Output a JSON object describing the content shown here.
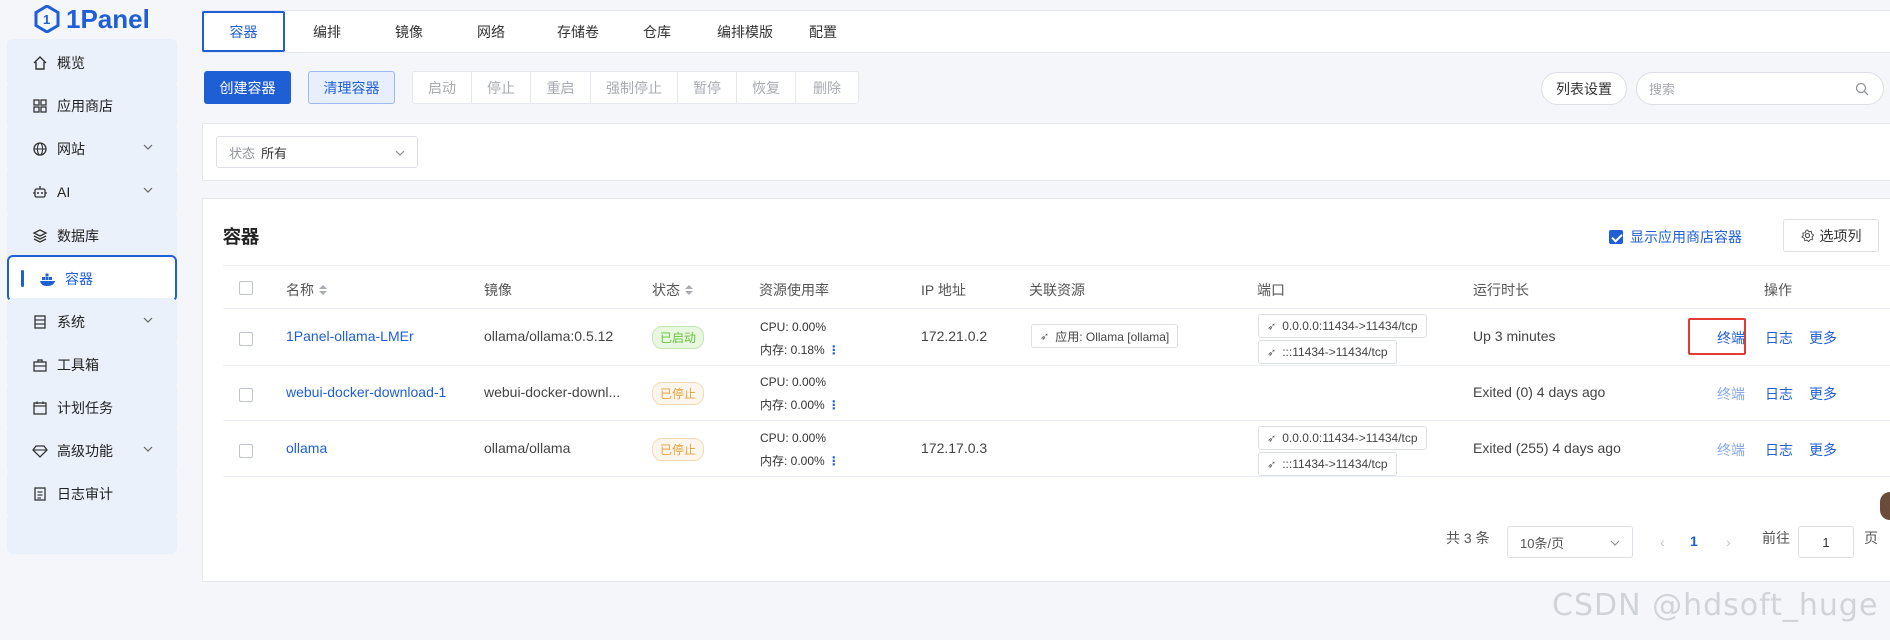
{
  "app": {
    "brand": "1Panel"
  },
  "sidebar": {
    "items": [
      {
        "label": "概览",
        "icon": "home-icon"
      },
      {
        "label": "应用商店",
        "icon": "grid-icon"
      },
      {
        "label": "网站",
        "icon": "globe-icon"
      },
      {
        "label": "AI",
        "icon": "robot-icon"
      },
      {
        "label": "数据库",
        "icon": "layers-icon"
      },
      {
        "label": "容器",
        "icon": "docker-icon",
        "active": true
      },
      {
        "label": "系统",
        "icon": "server-icon"
      },
      {
        "label": "工具箱",
        "icon": "toolbox-icon"
      },
      {
        "label": "计划任务",
        "icon": "calendar-icon"
      },
      {
        "label": "高级功能",
        "icon": "diamond-icon"
      },
      {
        "label": "日志审计",
        "icon": "log-icon"
      }
    ]
  },
  "tabs": [
    "容器",
    "编排",
    "镜像",
    "网络",
    "存储卷",
    "仓库",
    "编排模版",
    "配置"
  ],
  "toolbar": {
    "create": "创建容器",
    "clean": "清理容器",
    "actions": [
      "启动",
      "停止",
      "重启",
      "强制停止",
      "暂停",
      "恢复",
      "删除"
    ],
    "list_settings": "列表设置",
    "search_placeholder": "搜索"
  },
  "filter": {
    "prefix": "状态",
    "value": "所有"
  },
  "card": {
    "title": "容器",
    "show_app_containers": "显示应用商店容器",
    "columns_button": "选项列"
  },
  "table": {
    "headers": [
      "名称",
      "镜像",
      "状态",
      "资源使用率",
      "IP 地址",
      "关联资源",
      "端口",
      "运行时长",
      "操作"
    ],
    "rows": [
      {
        "name": "1Panel-ollama-LMEr",
        "image": "ollama/ollama:0.5.12",
        "status": "已启动",
        "cpu": "CPU: 0.00%",
        "mem": "内存: 0.18%",
        "ip": "172.21.0.2",
        "resource": "应用: Ollama [ollama]",
        "ports": [
          "0.0.0.0:11434->11434/tcp",
          ":::11434->11434/tcp"
        ],
        "uptime": "Up 3 minutes",
        "ops": [
          "终端",
          "日志",
          "更多"
        ]
      },
      {
        "name": "webui-docker-download-1",
        "image": "webui-docker-downl...",
        "status": "已停止",
        "cpu": "CPU: 0.00%",
        "mem": "内存: 0.00%",
        "ip": "",
        "resource": "",
        "ports": [],
        "uptime": "Exited (0) 4 days ago",
        "ops": [
          "终端",
          "日志",
          "更多"
        ]
      },
      {
        "name": "ollama",
        "image": "ollama/ollama",
        "status": "已停止",
        "cpu": "CPU: 0.00%",
        "mem": "内存: 0.00%",
        "ip": "172.17.0.3",
        "resource": "",
        "ports": [
          "0.0.0.0:11434->11434/tcp",
          ":::11434->11434/tcp"
        ],
        "uptime": "Exited (255) 4 days ago",
        "ops": [
          "终端",
          "日志",
          "更多"
        ]
      }
    ]
  },
  "pagination": {
    "total": "共 3 条",
    "page_size": "10条/页",
    "current": "1",
    "goto_label": "前往",
    "goto_value": "1",
    "page_suffix": "页"
  },
  "watermark": "CSDN @hdsoft_huge",
  "colors": {
    "accent": "#1f5fd6",
    "running": "#67c23a",
    "stopped": "#e6a23c",
    "highlight": "#e53935"
  }
}
